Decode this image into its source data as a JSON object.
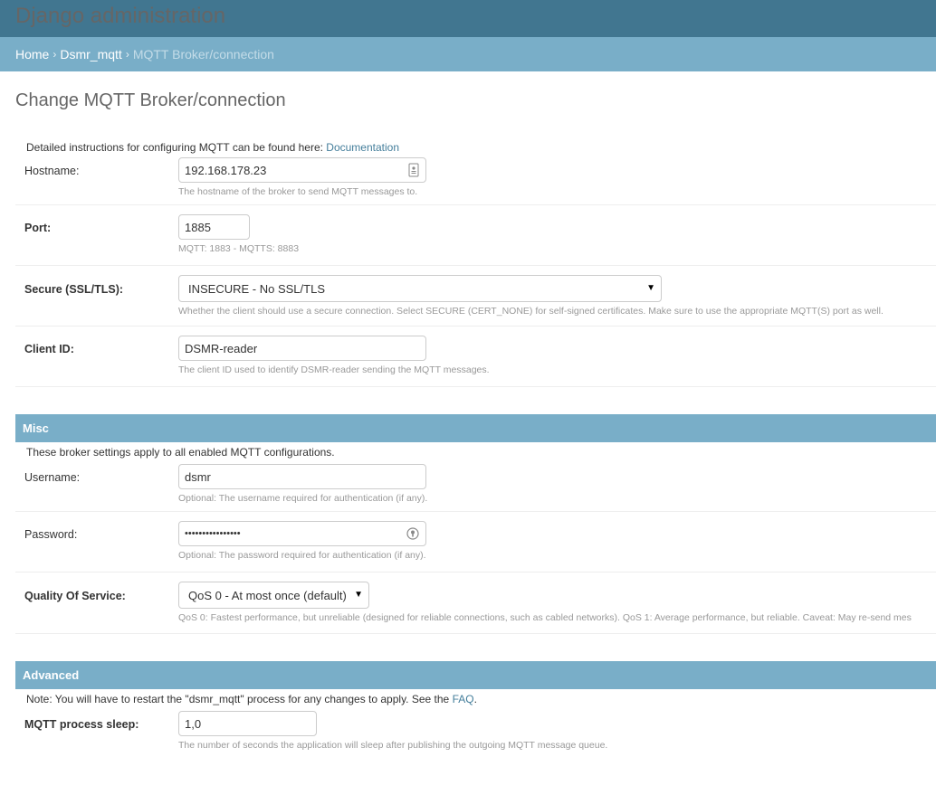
{
  "header": {
    "site_name": "Django administration"
  },
  "breadcrumbs": {
    "home": "Home",
    "app": "Dsmr_mqtt",
    "current": "MQTT Broker/connection",
    "sep": "›"
  },
  "page": {
    "title": "Change MQTT Broker/connection"
  },
  "main_fieldset": {
    "description_prefix": "Detailed instructions for configuring MQTT can be found here: ",
    "description_link": "Documentation",
    "hostname": {
      "label": "Hostname:",
      "value": "192.168.178.23",
      "help": "The hostname of the broker to send MQTT messages to."
    },
    "port": {
      "label": "Port:",
      "value": "1885",
      "help": "MQTT: 1883 - MQTTS: 8883"
    },
    "secure": {
      "label": "Secure (SSL/TLS):",
      "selected": "INSECURE - No SSL/TLS",
      "help": "Whether the client should use a secure connection. Select SECURE (CERT_NONE) for self-signed certificates. Make sure to use the appropriate MQTT(S) port as well."
    },
    "client_id": {
      "label": "Client ID:",
      "value": "DSMR-reader",
      "help": "The client ID used to identify DSMR-reader sending the MQTT messages."
    }
  },
  "misc": {
    "title": "Misc",
    "description": "These broker settings apply to all enabled MQTT configurations.",
    "username": {
      "label": "Username:",
      "value": "dsmr",
      "help": "Optional: The username required for authentication (if any)."
    },
    "password": {
      "label": "Password:",
      "value": "••••••••••••••••",
      "help": "Optional: The password required for authentication (if any)."
    },
    "qos": {
      "label": "Quality Of Service:",
      "selected": "QoS 0 - At most once (default)",
      "help": "QoS 0: Fastest performance, but unreliable (designed for reliable connections, such as cabled networks). QoS 1: Average performance, but reliable. Caveat: May re-send mes"
    }
  },
  "advanced": {
    "title": "Advanced",
    "description_prefix": "Note: You will have to restart the \"dsmr_mqtt\" process for any changes to apply. See the ",
    "description_link": "FAQ",
    "description_suffix": ".",
    "sleep": {
      "label": "MQTT process sleep:",
      "value": "1,0",
      "help": "The number of seconds the application will sleep after publishing the outgoing MQTT message queue."
    }
  },
  "colors": {
    "header_bg": "#417690",
    "header_text": "#f5dd5d",
    "breadcrumb_bg": "#79aec8",
    "link": "#447e9b"
  },
  "icons": {
    "hostname_field": "contact-card-icon",
    "password_field": "key-icon",
    "select_arrow": "triangle-down-icon"
  }
}
